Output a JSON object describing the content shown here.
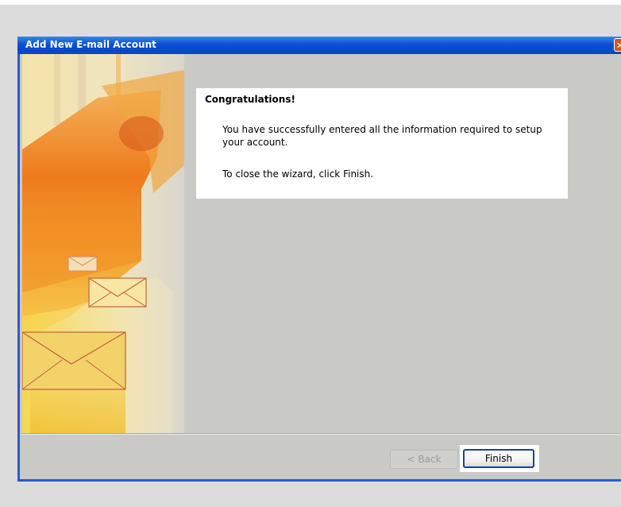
{
  "window": {
    "title": "Add New E-mail Account",
    "close_glyph": "✕"
  },
  "content": {
    "heading": "Congratulations!",
    "success_message": "You have successfully entered all the information required to setup your account.",
    "close_hint": "To close the wizard, click Finish."
  },
  "buttons": {
    "back_label": "< Back",
    "finish_label": "Finish"
  },
  "icons": {
    "close": "close-icon",
    "envelopes": "envelope-icon"
  },
  "colors": {
    "titlebar": "#0a4fd6",
    "dialog_background": "#c9c9c5",
    "art_orange": "#f07a1a",
    "art_yellow": "#f4d23a"
  }
}
